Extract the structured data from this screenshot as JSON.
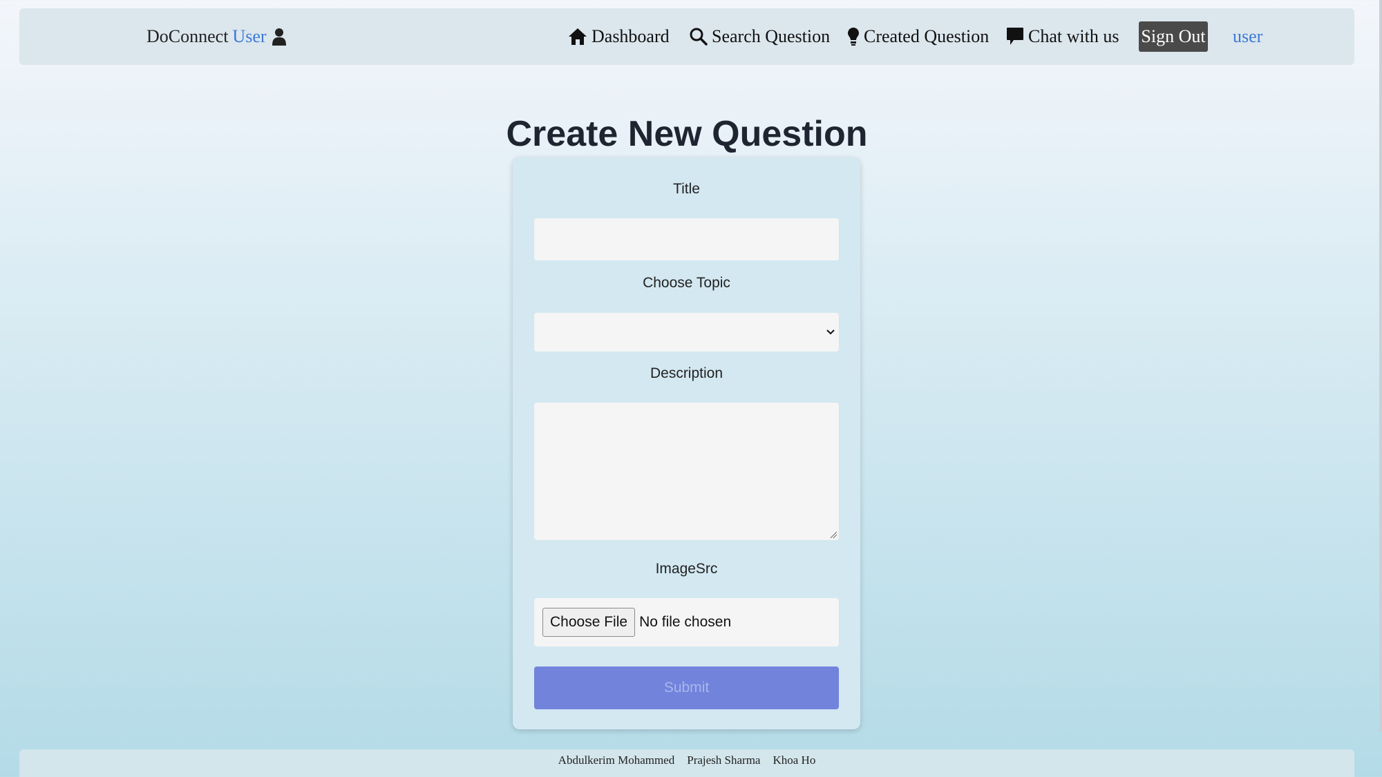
{
  "header": {
    "brand": "DoConnect",
    "brand_role": "User",
    "nav": {
      "dashboard": "Dashboard",
      "search": "Search Question",
      "created": "Created Question",
      "chat": "Chat with us"
    },
    "signout": "Sign Out",
    "username": "user"
  },
  "page": {
    "title": "Create New Question"
  },
  "form": {
    "title_label": "Title",
    "title_value": "",
    "topic_label": "Choose Topic",
    "topic_selected": "",
    "description_label": "Description",
    "description_value": "",
    "image_label": "ImageSrc",
    "choose_file": "Choose File",
    "file_status": "No file chosen",
    "submit": "Submit"
  },
  "footer": {
    "authors": [
      "Abdulkerim Mohammed",
      "Prajesh Sharma",
      "Khoa Ho"
    ]
  },
  "colors": {
    "accent_link": "#3a7ad6",
    "submit_bg": "#7283dc",
    "signout_bg": "#4a4a4a"
  }
}
